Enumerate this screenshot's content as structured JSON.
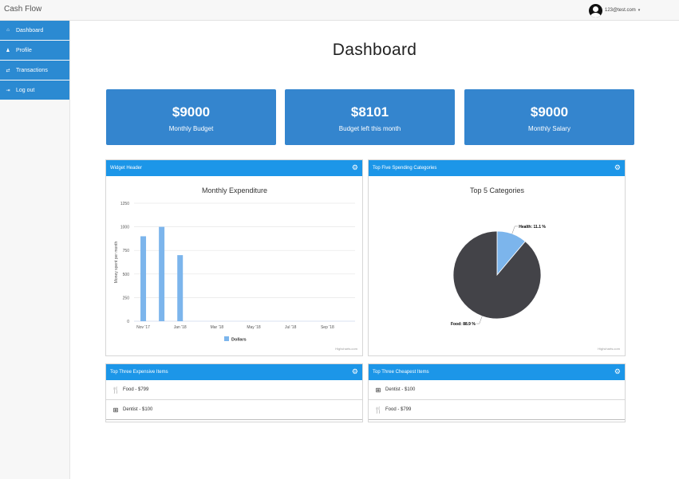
{
  "app": {
    "title": "Cash Flow"
  },
  "user": {
    "email": "123@test.com",
    "caret": "▾"
  },
  "sidebar": {
    "items": [
      {
        "label": "Dashboard",
        "icon": "home-icon",
        "glyph": "⌂"
      },
      {
        "label": "Profile",
        "icon": "user-icon",
        "glyph": "♟"
      },
      {
        "label": "Transactions",
        "icon": "exchange-icon",
        "glyph": "⇄"
      },
      {
        "label": "Log out",
        "icon": "logout-icon",
        "glyph": "⇥"
      }
    ]
  },
  "page": {
    "title": "Dashboard"
  },
  "stats": [
    {
      "value": "$9000",
      "label": "Monthly Budget"
    },
    {
      "value": "$8101",
      "label": "Budget left this month"
    },
    {
      "value": "$9000",
      "label": "Monthly Salary"
    }
  ],
  "widgets": {
    "bar": {
      "header": "Widget Header",
      "credit": "Highcharts.com"
    },
    "pie": {
      "header": "Top Five Spending Categories",
      "credit": "Highcharts.com"
    },
    "expensive": {
      "header": "Top Three Expensive Items",
      "items": [
        {
          "icon": "cutlery-icon",
          "glyph": "🍴",
          "text": "Food - $799"
        },
        {
          "icon": "medkit-icon",
          "glyph": "⊞",
          "text": "Dentist - $100"
        }
      ]
    },
    "cheapest": {
      "header": "Top Three Cheapest Items",
      "items": [
        {
          "icon": "medkit-icon",
          "glyph": "⊞",
          "text": "Dentist - $100"
        },
        {
          "icon": "cutlery-icon",
          "glyph": "🍴",
          "text": "Food - $799"
        }
      ]
    }
  },
  "colors": {
    "accent": "#2b8ad2",
    "header": "#1c96e8",
    "bar": "#7cb5ec",
    "pie_dark": "#434348",
    "pie_light": "#7cb5ec"
  },
  "chart_data": [
    {
      "type": "bar",
      "title": "Monthly Expenditure",
      "ylabel": "Money spent per month",
      "xlabel": "",
      "ylim": [
        0,
        1250
      ],
      "yticks": [
        0,
        250,
        500,
        750,
        1000,
        1250
      ],
      "x_tick_labels": [
        "Nov '17",
        "Jan '18",
        "Mar '18",
        "May '18",
        "Jul '18",
        "Sep '18"
      ],
      "categories": [
        "Nov '17",
        "Dec '17",
        "Jan '18"
      ],
      "series": [
        {
          "name": "Dollars",
          "values": [
            900,
            1000,
            700
          ]
        }
      ],
      "legend": "bottom-center",
      "grid": true
    },
    {
      "type": "pie",
      "title": "Top 5 Categories",
      "slices": [
        {
          "name": "Health",
          "value": 11.1,
          "label": "Health: 11.1 %"
        },
        {
          "name": "Food",
          "value": 88.9,
          "label": "Food: 88.9 %"
        }
      ]
    }
  ]
}
